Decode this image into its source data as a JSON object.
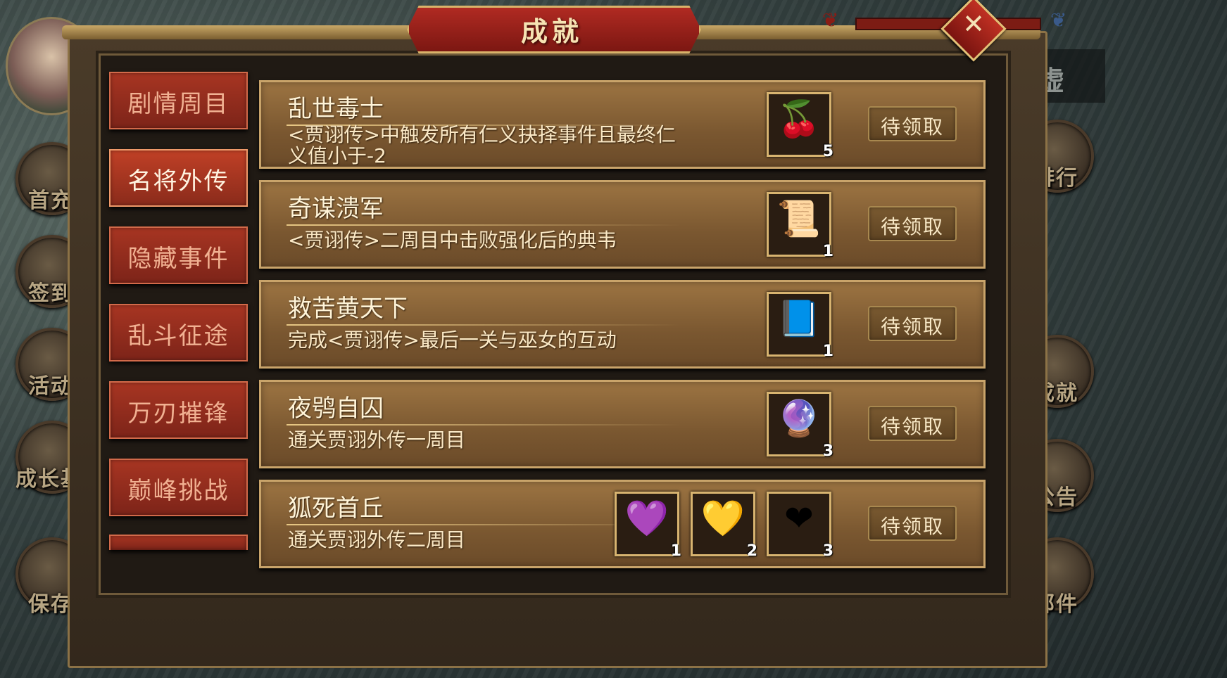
{
  "window": {
    "title": "成就",
    "close_glyph": "✕"
  },
  "left_menu": [
    {
      "label": "首充",
      "icon": "gift-box-icon"
    },
    {
      "label": "签到",
      "icon": "signin-scroll-icon"
    },
    {
      "label": "活动",
      "icon": "basket-icon"
    },
    {
      "label": "成长基金",
      "icon": "flower-pot-icon"
    },
    {
      "label": "保存",
      "icon": "save-arrow-icon"
    }
  ],
  "right_menu": [
    {
      "label": "排行",
      "icon": "ranking-board-icon"
    },
    {
      "label": "成就",
      "icon": "achievement-seal-icon"
    },
    {
      "label": "公告",
      "icon": "bamboo-scroll-icon"
    },
    {
      "label": "邮件",
      "icon": "mail-letter-icon"
    }
  ],
  "right_panel_text": "空虚",
  "tabs": [
    {
      "label": "剧情周目",
      "active": false
    },
    {
      "label": "名将外传",
      "active": true
    },
    {
      "label": "隐藏事件",
      "active": false
    },
    {
      "label": "乱斗征途",
      "active": false
    },
    {
      "label": "万刃摧锋",
      "active": false
    },
    {
      "label": "巅峰挑战",
      "active": false
    }
  ],
  "achievements": [
    {
      "name": "乱世毒士",
      "desc": "<贾诩传>中触发所有仁义抉择事件且最终仁义值小于-2",
      "rewards": [
        {
          "icon": "cherries-icon",
          "glyph": "🍒",
          "count": "5"
        }
      ],
      "button": "待领取"
    },
    {
      "name": "奇谋溃军",
      "desc": "<贾诩传>二周目中击败强化后的典韦",
      "rewards": [
        {
          "icon": "blue-scroll-icon",
          "glyph": "📜",
          "count": "1"
        }
      ],
      "button": "待领取"
    },
    {
      "name": "救苦黄天下",
      "desc": "完成<贾诩传>最后一关与巫女的互动",
      "rewards": [
        {
          "icon": "blue-book-icon",
          "glyph": "📘",
          "count": "1"
        }
      ],
      "button": "待领取"
    },
    {
      "name": "夜鸮自囚",
      "desc": "通关贾诩外传一周目",
      "rewards": [
        {
          "icon": "rainbow-orb-icon",
          "glyph": "🔮",
          "count": "3"
        }
      ],
      "button": "待领取"
    },
    {
      "name": "狐死首丘",
      "desc": "通关贾诩外传二周目",
      "rewards": [
        {
          "icon": "purple-gem-icon",
          "glyph": "💜",
          "count": "1"
        },
        {
          "icon": "gold-gem-icon",
          "glyph": "💛",
          "count": "2"
        },
        {
          "icon": "red-gem-icon",
          "glyph": "❤",
          "count": "3"
        }
      ],
      "button": "待领取"
    }
  ],
  "colors": {
    "accent_red": "#a73522",
    "panel_gold": "#c9a46a",
    "text_cream": "#fff4d8"
  }
}
